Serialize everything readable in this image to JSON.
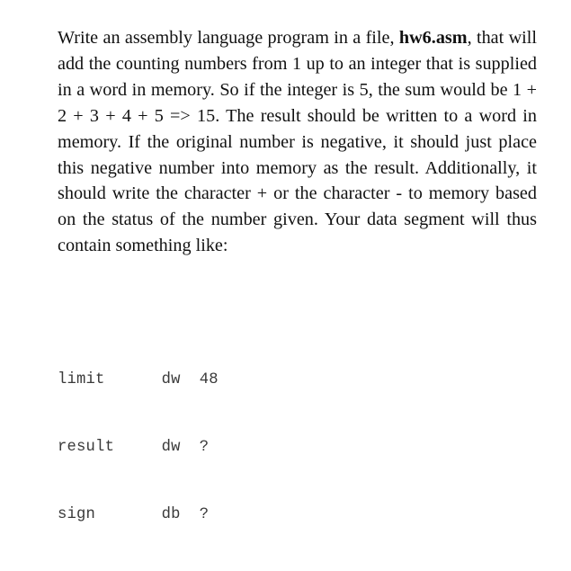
{
  "document": {
    "type": "assignment-prompt",
    "background_color": "#ffffff",
    "text_color": "#111111",
    "code_text_color": "#3a3a3a"
  },
  "paragraph": {
    "segment_1": "Write an assembly language program in a file, ",
    "filename_bold": "hw6.asm",
    "segment_2": ", that will add the counting numbers from 1 up to an integer that is supplied in a word in memory. So if the integer is 5, the sum would be 1 + 2 + 3 + 4 + 5 => 15. The result should be written to a word in memory. If the original number is negative, it should just place this negative number into memory as the result. Additionally, it should write the character + or the character - to memory based on the status of the number given. Your data segment will thus contain something like:"
  },
  "code_block": {
    "lines": [
      {
        "label": "limit",
        "directive": "dw",
        "value": "48"
      },
      {
        "label": "result",
        "directive": "dw",
        "value": "?"
      },
      {
        "label": "sign",
        "directive": "db",
        "value": "?"
      }
    ],
    "rendered": [
      "limit      dw  48",
      "result     dw  ?",
      "sign       db  ?"
    ]
  }
}
